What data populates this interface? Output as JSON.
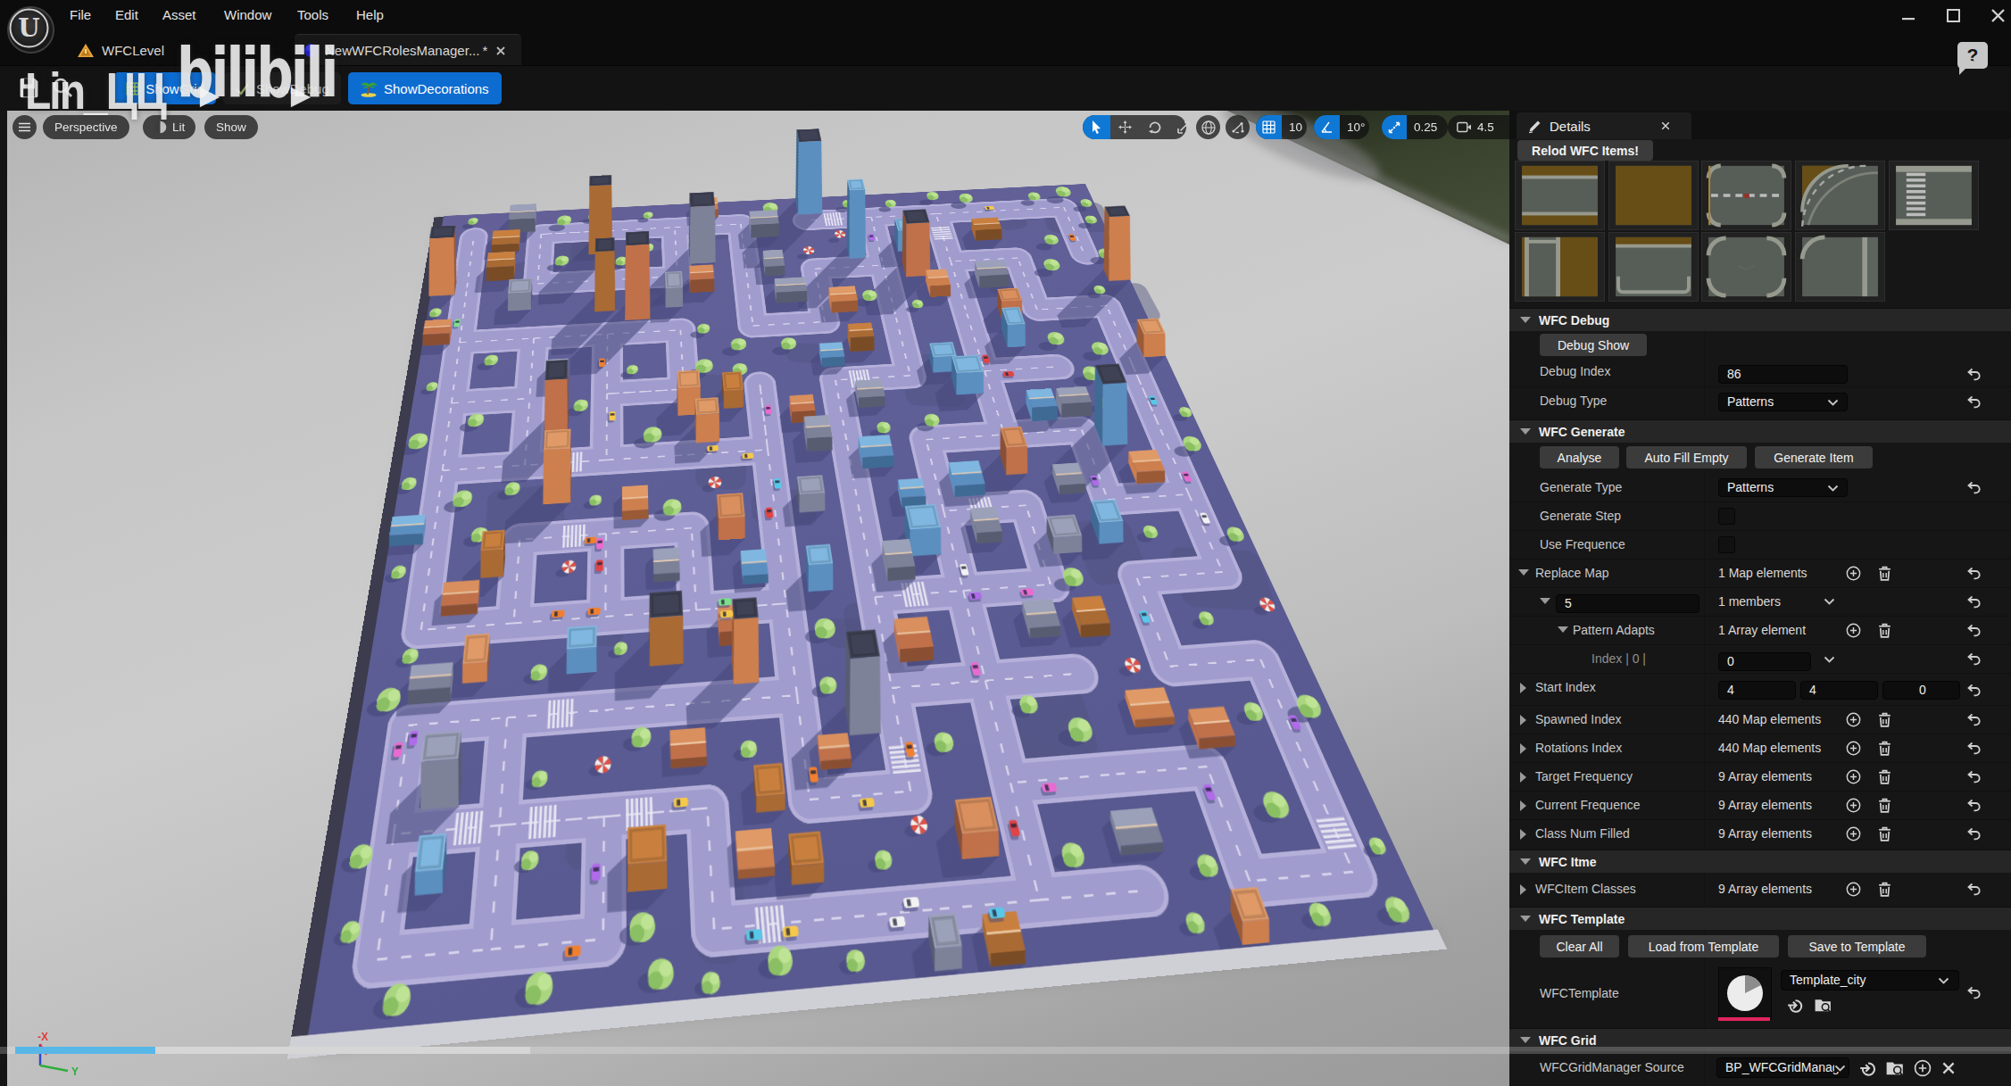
{
  "window": {
    "menu": [
      "File",
      "Edit",
      "Asset",
      "Window",
      "Tools",
      "Help"
    ],
    "help_icon": "?"
  },
  "tabs": {
    "level_tab": "WFCLevel",
    "asset_tab": "NewWFCRolesManager...",
    "asset_tab_dirty": "*"
  },
  "toolbar": {
    "show_grid": "ShowGrid",
    "show_debug": "ShowDebug",
    "show_decorations": "ShowDecorations"
  },
  "watermark": {
    "user": "Lin_ЦЦ",
    "site": "bilibili"
  },
  "viewport": {
    "mode": "Perspective",
    "lit": "Lit",
    "show": "Show",
    "snap_grid": "10",
    "snap_angle": "10°",
    "snap_scale": "0.25",
    "camera_speed": "4.5",
    "axis_x": "-X",
    "axis_y": "Y"
  },
  "details": {
    "title": "Details",
    "reload_button": "Relod WFC Items!",
    "wfc_debug": {
      "header": "WFC Debug",
      "debug_show": "Debug Show",
      "debug_index_label": "Debug Index",
      "debug_index_value": "86",
      "debug_type_label": "Debug Type",
      "debug_type_value": "Patterns"
    },
    "wfc_generate": {
      "header": "WFC Generate",
      "analyse": "Analyse",
      "auto_fill": "Auto Fill Empty",
      "generate_item": "Generate Item",
      "generate_type_label": "Generate Type",
      "generate_type_value": "Patterns",
      "generate_step_label": "Generate Step",
      "use_frequence_label": "Use Frequence",
      "replace_map_label": "Replace Map",
      "replace_map_value": "1 Map elements",
      "member_key": "5",
      "member_value": "1 members",
      "pattern_adapts_label": "Pattern Adapts",
      "pattern_adapts_value": "1 Array element",
      "index0_label": "Index | 0 |",
      "index0_value": "0",
      "start_index_label": "Start Index",
      "start_index_values": [
        "4",
        "4",
        "0"
      ],
      "spawned_index_label": "Spawned Index",
      "spawned_index_value": "440 Map elements",
      "rotations_index_label": "Rotations Index",
      "rotations_index_value": "440 Map elements",
      "target_frequency_label": "Target Frequency",
      "target_frequency_value": "9 Array elements",
      "current_frequence_label": "Current Frequence",
      "current_frequence_value": "9 Array elements",
      "class_num_filled_label": "Class Num Filled",
      "class_num_filled_value": "9 Array elements"
    },
    "wfc_itme": {
      "header": "WFC Itme",
      "classes_label": "WFCItem Classes",
      "classes_value": "9 Array elements"
    },
    "wfc_template": {
      "header": "WFC Template",
      "clear_all": "Clear All",
      "load_from_template": "Load from Template",
      "save_to_template": "Save to Template",
      "template_label": "WFCTemplate",
      "template_value": "Template_city"
    },
    "wfc_grid": {
      "header": "WFC Grid",
      "source_label": "WFCGridManager Source",
      "source_value": "BP_WFCGridManag"
    }
  },
  "colors": {
    "accent_blue": "#0d6cd0",
    "viewport_active_blue": "#0f78d4",
    "ground_purple": "#5e5f97",
    "road_lavender": "#a29dce",
    "wedge_green": "#3a422f",
    "progress_blue": "#59b7e8",
    "template_underline_red": "#e3255f"
  },
  "city": {
    "seed": 12,
    "grid_nodes": 10,
    "ground": "#5e5f97",
    "ground_dark": "#50517f",
    "road": "#a19cce",
    "road_edge": "#b5b0da",
    "dash": "#eeecf8",
    "shadow": "#46477a",
    "tree_light": "#aad680",
    "tree_dark": "#8abf63",
    "building_palettes": [
      [
        "#d98f5e",
        "#c0714a",
        "#8a4f33"
      ],
      [
        "#e09a67",
        "#cd7f4e",
        "#9a5a36"
      ],
      [
        "#7fb7e0",
        "#5b8fc0",
        "#3f6a94"
      ],
      [
        "#9ba1b8",
        "#7d8299",
        "#585c70"
      ],
      [
        "#c9803f",
        "#a96a34",
        "#7a4c26"
      ]
    ],
    "tower_roof": "#3f4254",
    "car_colors": [
      "#e04444",
      "#e96bd1",
      "#58c8e8",
      "#f2f2f2",
      "#f5c84b",
      "#7ce08a",
      "#b06be9",
      "#f08030"
    ]
  }
}
